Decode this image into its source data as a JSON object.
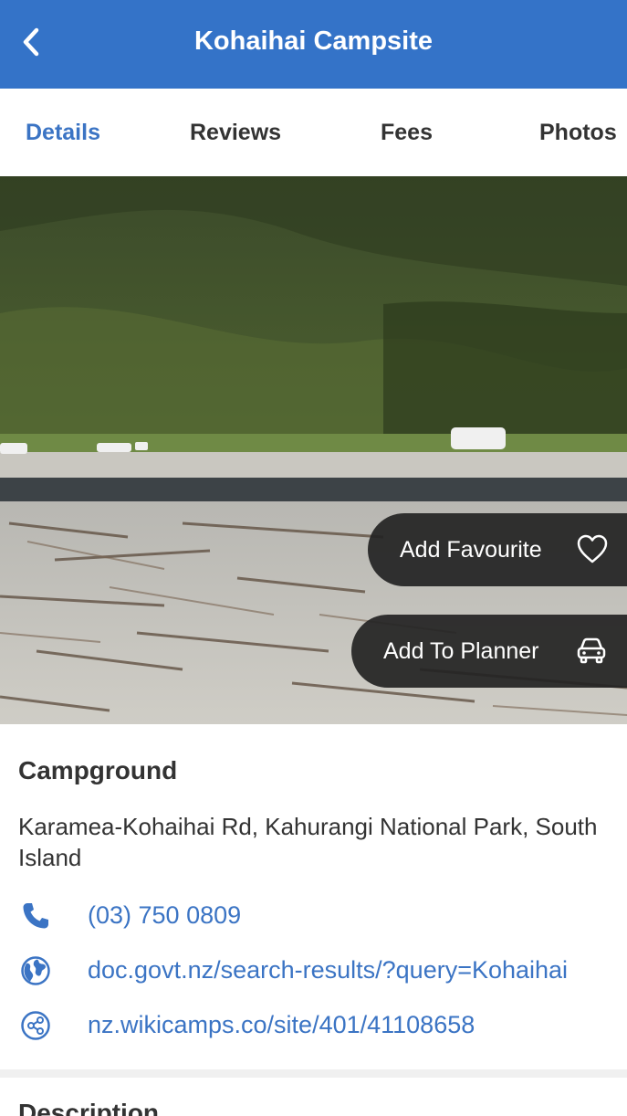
{
  "header": {
    "title": "Kohaihai Campsite",
    "back_icon": "chevron-left-icon",
    "background": "#3473c8"
  },
  "tabs": [
    {
      "label": "Details",
      "active": true
    },
    {
      "label": "Reviews",
      "active": false
    },
    {
      "label": "Fees",
      "active": false
    },
    {
      "label": "Photos",
      "active": false
    }
  ],
  "hero": {
    "actions": {
      "favourite_label": "Add Favourite",
      "favourite_icon": "heart-outline-icon",
      "planner_label": "Add To Planner",
      "planner_icon": "car-icon"
    }
  },
  "details": {
    "category": "Campground",
    "address": "Karamea-Kohaihai Rd, Kahurangi National Park, South Island",
    "phone": "(03) 750 0809",
    "phone_icon": "phone-icon",
    "website": "doc.govt.nz/search-results/?query=Kohaihai",
    "website_icon": "globe-icon",
    "share_link": "nz.wikicamps.co/site/401/41108658",
    "share_icon": "share-icon"
  },
  "next_section": {
    "title": "Description"
  },
  "colors": {
    "accent": "#3b74c4",
    "pill": "#232323"
  }
}
